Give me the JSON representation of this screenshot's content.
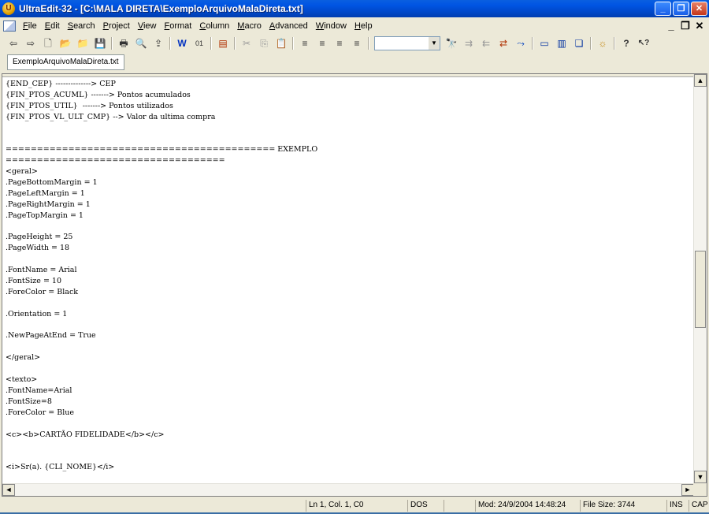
{
  "window": {
    "title": "UltraEdit-32 - [C:\\MALA DIRETA\\ExemploArquivoMalaDireta.txt]",
    "app_icon": "U",
    "minimize": "_",
    "maximize": "❐",
    "close": "✕"
  },
  "menu": [
    "File",
    "Edit",
    "Search",
    "Project",
    "View",
    "Format",
    "Column",
    "Macro",
    "Advanced",
    "Window",
    "Help"
  ],
  "mdi": {
    "minimize": "_",
    "restore": "❐",
    "close": "✕"
  },
  "toolbar": {
    "group1": [
      {
        "name": "back-icon",
        "glyph": "⇦"
      },
      {
        "name": "forward-icon",
        "glyph": "⇨"
      },
      {
        "name": "new-file-icon",
        "glyph": "🗋"
      },
      {
        "name": "open-folder-icon",
        "glyph": "📂"
      },
      {
        "name": "open-icon",
        "glyph": "📁"
      },
      {
        "name": "save-icon",
        "glyph": "💾"
      }
    ],
    "group2": [
      {
        "name": "print-icon",
        "glyph": "🖶"
      },
      {
        "name": "print-preview-icon",
        "glyph": "🔍"
      },
      {
        "name": "ftp-icon",
        "glyph": "⇪"
      }
    ],
    "group3": [
      {
        "name": "word-wrap-icon",
        "glyph": "W"
      },
      {
        "name": "hex-icon",
        "glyph": "01"
      }
    ],
    "group4": [
      {
        "name": "column-mode-icon",
        "glyph": "▤"
      }
    ],
    "group5": [
      {
        "name": "cut-icon",
        "glyph": "✂"
      },
      {
        "name": "copy-icon",
        "glyph": "⎘"
      },
      {
        "name": "paste-icon",
        "glyph": "📋"
      }
    ],
    "group6": [
      {
        "name": "align-left-icon",
        "glyph": "≡"
      },
      {
        "name": "align-center-icon",
        "glyph": "≡"
      },
      {
        "name": "align-right-icon",
        "glyph": "≡"
      },
      {
        "name": "justify-icon",
        "glyph": "≡"
      }
    ],
    "find_value": "",
    "group7": [
      {
        "name": "find-icon",
        "glyph": "🔭"
      },
      {
        "name": "find-next-icon",
        "glyph": "⇉"
      },
      {
        "name": "find-prev-icon",
        "glyph": "⇇"
      },
      {
        "name": "replace-icon",
        "glyph": "⇄"
      },
      {
        "name": "goto-icon",
        "glyph": "⤳"
      }
    ],
    "group8": [
      {
        "name": "split-horizontal-icon",
        "glyph": "▭"
      },
      {
        "name": "split-vertical-icon",
        "glyph": "▥"
      },
      {
        "name": "window-icon",
        "glyph": "❏"
      }
    ],
    "group9": [
      {
        "name": "settings-icon",
        "glyph": "☼"
      }
    ],
    "group10": [
      {
        "name": "help-icon",
        "glyph": "?"
      },
      {
        "name": "context-help-icon",
        "glyph": "↖?"
      }
    ]
  },
  "tab": {
    "label": "ExemploArquivoMalaDireta.txt"
  },
  "editor_lines": [
    "{END_CEP} --------------> CEP",
    "{FIN_PTOS_ACUML} -------> Pontos acumulados",
    "{FIN_PTOS_UTIL}  -------> Pontos utilizados",
    "{FIN_PTOS_VL_ULT_CMP} --> Valor da ultima compra",
    "",
    "",
    "=========================================== EXEMPLO",
    "===================================",
    "<geral>",
    ".PageBottomMargin = 1",
    ".PageLeftMargin = 1",
    ".PageRightMargin = 1",
    ".PageTopMargin = 1",
    "",
    ".PageHeight = 25",
    ".PageWidth = 18",
    "",
    ".FontName = Arial",
    ".FontSize = 10",
    ".ForeColor = Black",
    "",
    ".Orientation = 1",
    "",
    ".NewPageAtEnd = True",
    "",
    "</geral>",
    "",
    "<texto>",
    ".FontName=Arial",
    ".FontSize=8",
    ".ForeColor = Blue",
    "",
    "<c><b>CARTÃO FIDELIDADE</b></c>",
    "",
    "",
    "<i>Sr(a). {CLI_NOME}</i>"
  ],
  "scroll": {
    "up": "▲",
    "down": "▼",
    "left": "◄",
    "right": "►"
  },
  "status": {
    "position": "Ln 1, Col. 1, C0",
    "format": "DOS",
    "modified": "Mod: 24/9/2004 14:48:24",
    "file_size": "File Size: 3744",
    "ins": "INS",
    "cap": "CAP"
  }
}
